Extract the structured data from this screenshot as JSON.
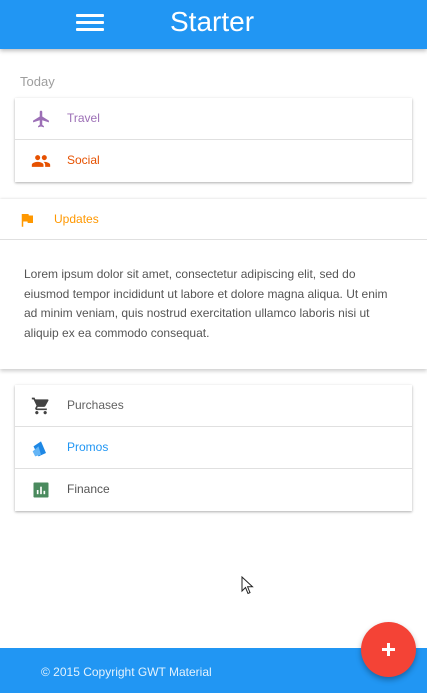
{
  "appbar": {
    "title": "Starter",
    "menu_icon": "hamburger-menu-icon",
    "color": "#2196f3"
  },
  "today": {
    "label": "Today",
    "items": [
      {
        "label": "Travel",
        "icon": "airplane-icon",
        "color": "#9c6fb6"
      },
      {
        "label": "Social",
        "icon": "people-icon",
        "color": "#e65100"
      }
    ]
  },
  "updates": {
    "label": "Updates",
    "icon": "flag-icon",
    "color": "#ff9800",
    "body": "Lorem ipsum dolor sit amet, consectetur adipiscing elit, sed do eiusmod tempor incididunt ut labore et dolore magna aliqua. Ut enim ad minim veniam, quis nostrud exercitation ullamco laboris nisi ut aliquip ex ea commodo consequat."
  },
  "categories": {
    "items": [
      {
        "label": "Purchases",
        "icon": "shopping-cart-icon",
        "color": "#616161"
      },
      {
        "label": "Promos",
        "icon": "promos-tag-icon",
        "color": "#2196f3"
      },
      {
        "label": "Finance",
        "icon": "bar-chart-icon",
        "color": "#4a8a5e"
      }
    ]
  },
  "fab": {
    "icon": "plus-icon",
    "color": "#f44336"
  },
  "footer": {
    "text": "© 2015 Copyright GWT Material"
  }
}
